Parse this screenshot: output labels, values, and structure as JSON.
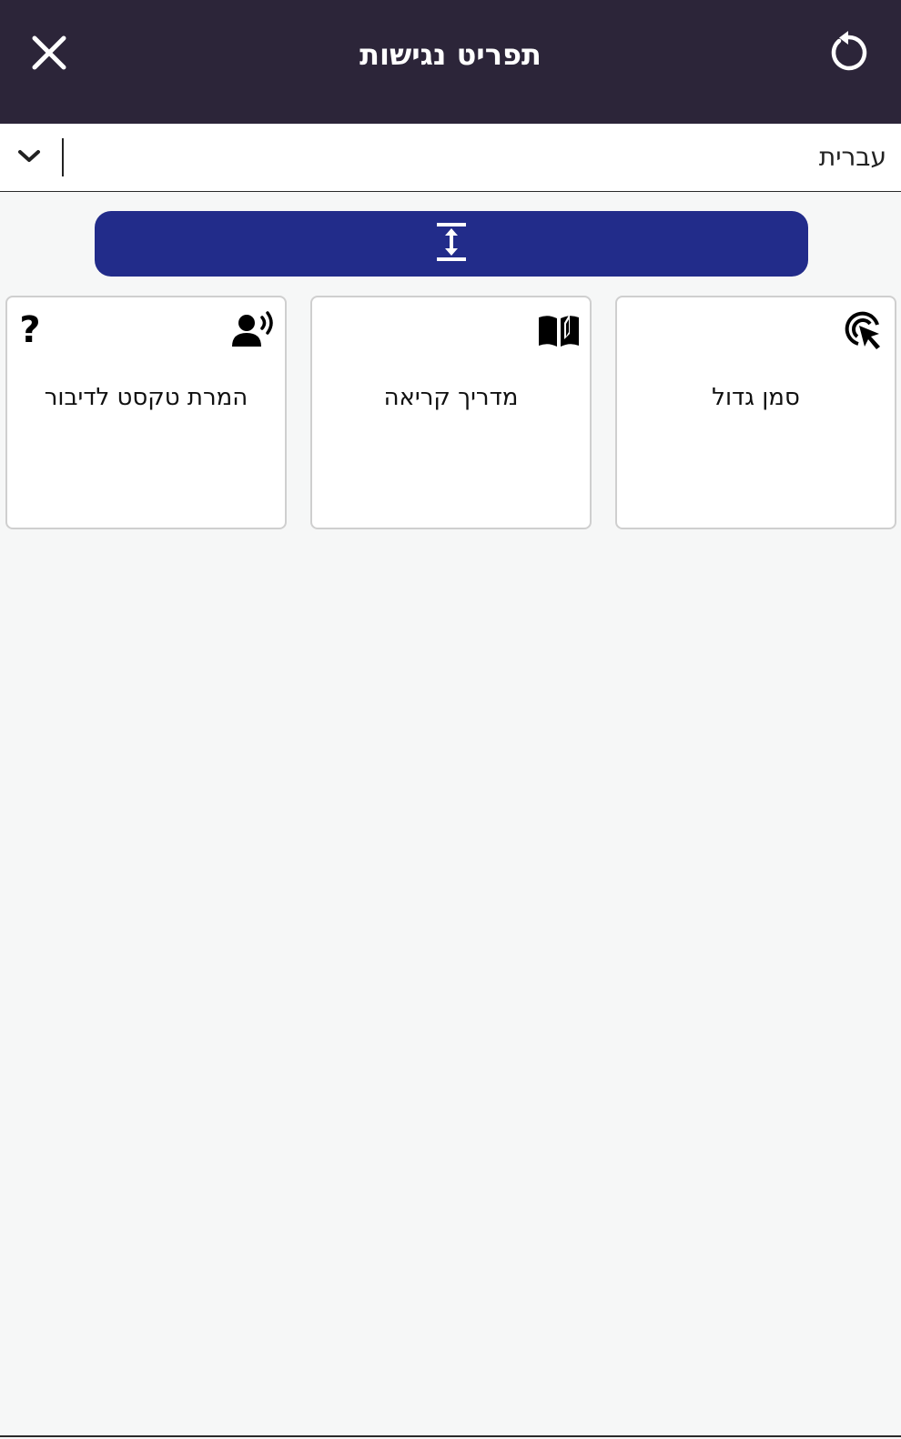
{
  "header": {
    "title": "תפריט נגישות",
    "close_icon": "close-icon",
    "reset_icon": "reset-icon"
  },
  "language": {
    "selected": "עברית",
    "chevron_icon": "chevron-down-icon"
  },
  "expand_button": {
    "icon": "vertical-expand-icon"
  },
  "cards": [
    {
      "label": "סמן גדול",
      "icon": "large-cursor-icon"
    },
    {
      "label": "מדריך קריאה",
      "icon": "open-book-icon"
    },
    {
      "label": "המרת טקסט לדיבור",
      "icon": "speaking-person-icon",
      "help_label": "?"
    }
  ],
  "colors": {
    "header_bg": "#2c2539",
    "accent": "#222c8a",
    "page_bg": "#f6f7f7"
  }
}
